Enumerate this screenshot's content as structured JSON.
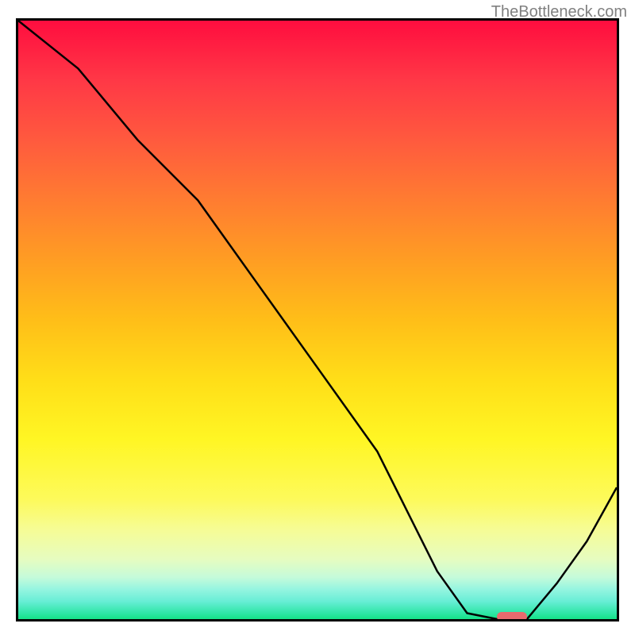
{
  "watermark": "TheBottleneck.com",
  "chart_data": {
    "type": "line",
    "title": "",
    "xlabel": "",
    "ylabel": "",
    "xlim": [
      0,
      100
    ],
    "ylim": [
      0,
      100
    ],
    "x": [
      0,
      10,
      20,
      30,
      40,
      50,
      60,
      65,
      70,
      75,
      80,
      85,
      90,
      95,
      100
    ],
    "values": [
      100,
      92,
      80,
      70,
      56,
      42,
      28,
      18,
      8,
      1,
      0,
      0,
      6,
      13,
      22
    ],
    "marker": {
      "x_start": 80,
      "x_end": 85,
      "y": 0
    },
    "background_gradient_stops": [
      {
        "pct": 0,
        "color": "#ff0d3f"
      },
      {
        "pct": 50,
        "color": "#ffbe18"
      },
      {
        "pct": 80,
        "color": "#fdfa5b"
      },
      {
        "pct": 100,
        "color": "#15e287"
      }
    ]
  }
}
